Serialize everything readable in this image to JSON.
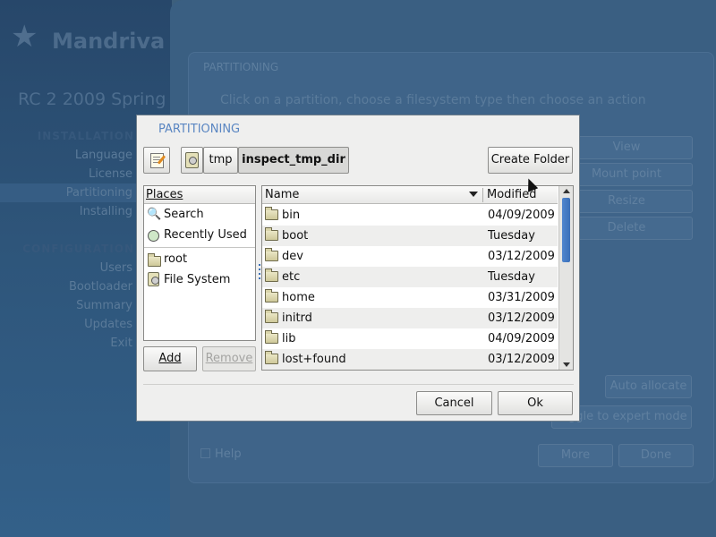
{
  "sidebar": {
    "brand": "Mandriva",
    "release": "RC 2 2009 Spring",
    "sections": [
      {
        "label": "INSTALLATION",
        "items": [
          "Language",
          "License",
          "Partitioning",
          "Installing"
        ]
      },
      {
        "label": "CONFIGURATION",
        "items": [
          "Users",
          "Bootloader",
          "Summary",
          "Updates",
          "Exit"
        ]
      }
    ]
  },
  "background": {
    "panel_title": "PARTITIONING",
    "instruction": "Click on a partition, choose a filesystem type then choose an action",
    "buttons": [
      "View",
      "Mount point",
      "Resize",
      "Delete",
      "Auto allocate",
      "Toggle to expert mode",
      "More",
      "Done"
    ],
    "help_label": "Help"
  },
  "dialog": {
    "title": "PARTITIONING",
    "breadcrumb": [
      "tmp",
      "inspect_tmp_dir"
    ],
    "create_folder_label": "Create Folder",
    "places": {
      "header": "Places",
      "items": [
        "Search",
        "Recently Used",
        "root",
        "File System"
      ],
      "add_label": "Add",
      "remove_label": "Remove"
    },
    "files": {
      "columns": [
        "Name",
        "Modified"
      ],
      "rows": [
        {
          "name": "bin",
          "modified": "04/09/2009"
        },
        {
          "name": "boot",
          "modified": "Tuesday"
        },
        {
          "name": "dev",
          "modified": "03/12/2009"
        },
        {
          "name": "etc",
          "modified": "Tuesday"
        },
        {
          "name": "home",
          "modified": "03/31/2009"
        },
        {
          "name": "initrd",
          "modified": "03/12/2009"
        },
        {
          "name": "lib",
          "modified": "04/09/2009"
        },
        {
          "name": "lost+found",
          "modified": "03/12/2009"
        }
      ]
    },
    "cancel_label": "Cancel",
    "ok_label": "Ok"
  },
  "colors": {
    "dialog_title": "#5a86c2",
    "scroll_thumb": "#4f86cf"
  }
}
